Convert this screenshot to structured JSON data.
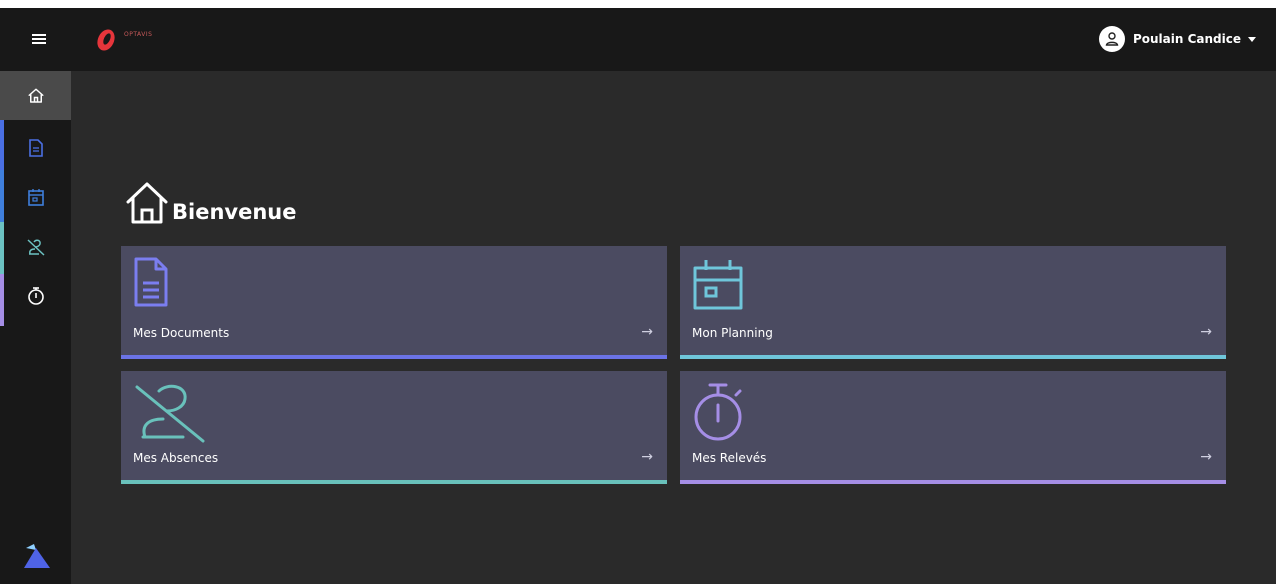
{
  "brand": {
    "logo_text": "OPTAVIS"
  },
  "user": {
    "name": "Poulain Candice"
  },
  "sidebar": {
    "items": [
      {
        "name": "home",
        "icon": "home-icon",
        "color": "#ffffff"
      },
      {
        "name": "documents",
        "icon": "document-icon",
        "color": "#4a6fe3"
      },
      {
        "name": "planning",
        "icon": "calendar-icon",
        "color": "#3f7fdc"
      },
      {
        "name": "absences",
        "icon": "user-off-icon",
        "color": "#6cc2c2"
      },
      {
        "name": "releves",
        "icon": "stopwatch-icon",
        "color": "#ffffff"
      }
    ]
  },
  "main": {
    "welcome_title": "Bienvenue",
    "cards": [
      {
        "label": "Mes Documents",
        "icon": "document-icon",
        "accent": "#6b73e6",
        "arrow": "→"
      },
      {
        "label": "Mon Planning",
        "icon": "calendar-icon",
        "accent": "#6fc6da",
        "arrow": "→"
      },
      {
        "label": "Mes Absences",
        "icon": "user-off-icon",
        "accent": "#69c1bb",
        "arrow": "→"
      },
      {
        "label": "Mes Relevés",
        "icon": "stopwatch-icon",
        "accent": "#a58ee6",
        "arrow": "→"
      }
    ]
  }
}
